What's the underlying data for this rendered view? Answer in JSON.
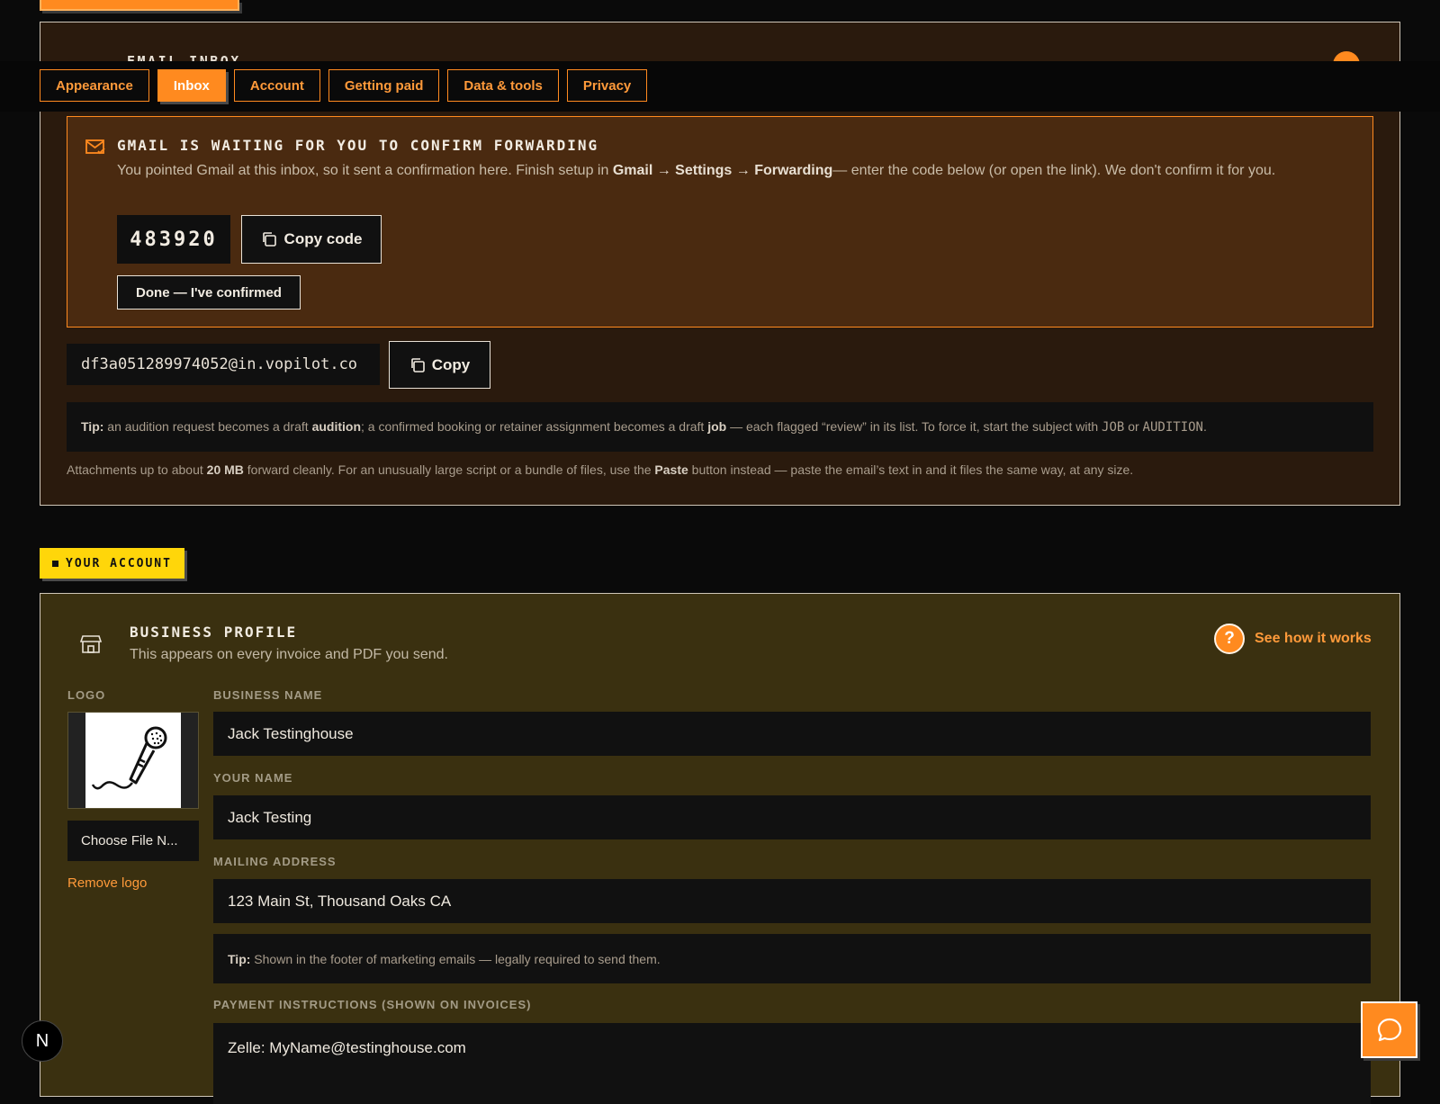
{
  "inbox": {
    "title": "EMAIL INBOX",
    "tabs": [
      {
        "label": "Appearance",
        "active": false
      },
      {
        "label": "Inbox",
        "active": true
      },
      {
        "label": "Account",
        "active": false
      },
      {
        "label": "Getting paid",
        "active": false
      },
      {
        "label": "Data & tools",
        "active": false
      },
      {
        "label": "Privacy",
        "active": false
      }
    ],
    "alert": {
      "title": "GMAIL IS WAITING FOR YOU TO CONFIRM FORWARDING",
      "body_pre": "You pointed Gmail at this inbox, so it sent a confirmation here. Finish setup in ",
      "body_path": "Gmail → Settings → Forwarding",
      "body_post": "— enter the code below (or open the link). We don't confirm it for you.",
      "code": "483920",
      "copy_code_label": "Copy code",
      "done_label": "Done — I've confirmed"
    },
    "address": "df3a051289974052@in.vopilot.co",
    "copy_label": "Copy",
    "tip": {
      "lead": "Tip:",
      "t1": " an audition request becomes a draft ",
      "b1": "audition",
      "t2": "; a confirmed booking or retainer assignment becomes a draft ",
      "b2": "job",
      "t3": " — each flagged “review” in its list. To force it, start the subject with ",
      "c1": "JOB",
      "t4": " or ",
      "c2": "AUDITION",
      "t5": "."
    },
    "note": {
      "t1": "Attachments up to about ",
      "b1": "20 MB",
      "t2": " forward cleanly. For an unusually large script or a bundle of files, use the ",
      "b2": "Paste",
      "t3": " button instead — paste the email’s text in and it files the same way, at any size."
    }
  },
  "account": {
    "badge": "YOUR ACCOUNT",
    "profile": {
      "title": "BUSINESS PROFILE",
      "subtitle": "This appears on every invoice and PDF you send.",
      "help_label": "See how it works",
      "logo_label": "LOGO",
      "choose_file_label": "Choose File N...",
      "remove_logo_label": "Remove logo",
      "business_name_label": "BUSINESS NAME",
      "business_name": "Jack Testinghouse",
      "your_name_label": "YOUR NAME",
      "your_name": "Jack Testing",
      "mailing_address_label": "MAILING ADDRESS",
      "mailing_address": "123 Main St, Thousand Oaks CA",
      "tip_lead": "Tip:",
      "tip_text": " Shown in the footer of marketing emails — legally required to send them.",
      "payment_label": "PAYMENT INSTRUCTIONS (SHOWN ON INVOICES)",
      "payment": "Zelle: MyName@testinghouse.com"
    }
  },
  "floating": {
    "n_badge": "N",
    "chat_icon": "chat-bubble-icon"
  },
  "colors": {
    "accent": "#ff8a1f",
    "badge": "#ffd60a",
    "inbox_card_bg": "#2a1a0d",
    "alert_bg": "#4a2a10",
    "profile_card_bg": "#3a3010"
  }
}
